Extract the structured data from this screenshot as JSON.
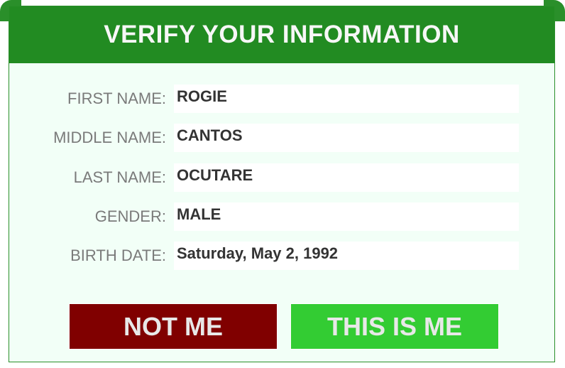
{
  "header": {
    "title": "VERIFY YOUR INFORMATION"
  },
  "fields": [
    {
      "label": "FIRST NAME:",
      "value": "ROGIE"
    },
    {
      "label": "MIDDLE NAME:",
      "value": "CANTOS"
    },
    {
      "label": "LAST NAME:",
      "value": "OCUTARE"
    },
    {
      "label": "GENDER:",
      "value": "MALE"
    },
    {
      "label": "BIRTH DATE:",
      "value": "Saturday, May 2, 1992"
    }
  ],
  "buttons": {
    "not_me": "NOT ME",
    "this_is_me": "THIS IS ME"
  },
  "colors": {
    "header_bg": "#228b22",
    "panel_bg": "#f2fff7",
    "not_me_bg": "#800000",
    "this_is_me_bg": "#33cc33"
  }
}
